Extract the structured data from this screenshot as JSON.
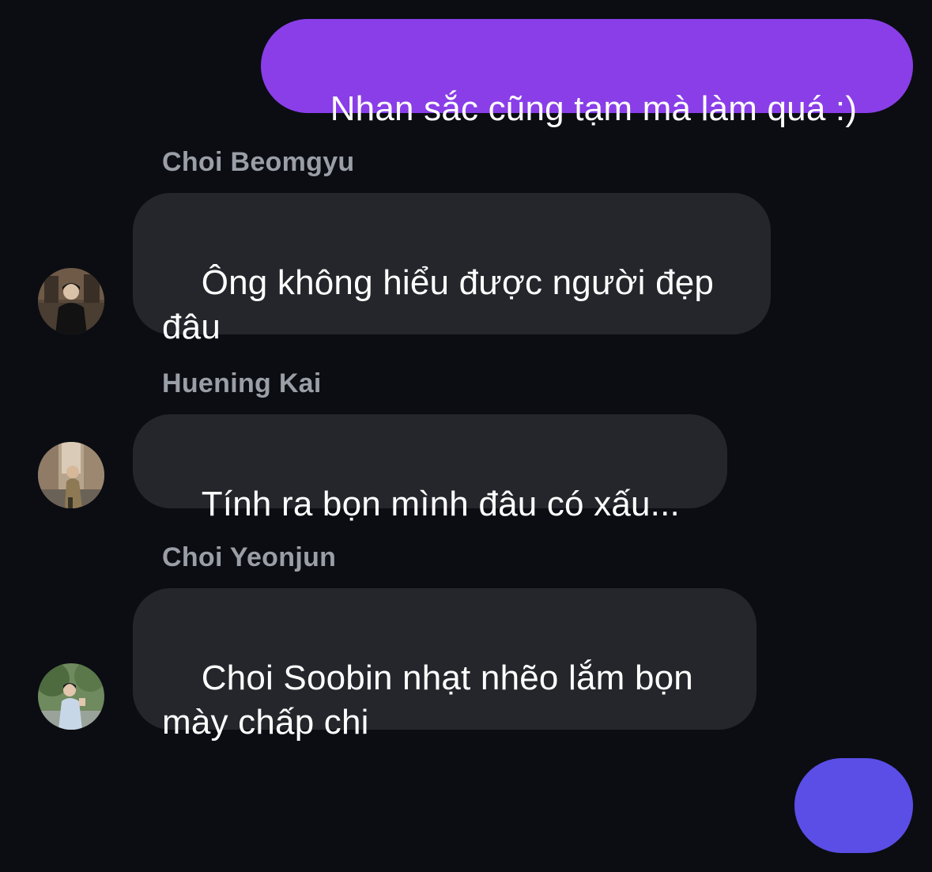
{
  "colors": {
    "background": "#0b0d13",
    "outgoing_bubble_1": "#8a3ee8",
    "outgoing_bubble_2": "#5b4ee6",
    "incoming_bubble": "#24262b",
    "sender_name": "#9a9ea6",
    "message_text": "#ffffff"
  },
  "messages": [
    {
      "direction": "outgoing",
      "text": "Nhan sắc cũng tạm mà làm quá :)"
    },
    {
      "direction": "incoming",
      "sender": "Choi Beomgyu",
      "text": "Ông không hiểu được người đẹp\nđâu",
      "avatar": "avatar-photo"
    },
    {
      "direction": "incoming",
      "sender": "Huening Kai",
      "text": "Tính ra bọn mình đâu có xấu...",
      "avatar": "avatar-photo"
    },
    {
      "direction": "incoming",
      "sender": "Choi Yeonjun",
      "text": "Choi Soobin nhạt nhẽo lắm bọn\nmày chấp chi",
      "avatar": "avatar-photo"
    },
    {
      "direction": "outgoing",
      "text": ":)..."
    }
  ]
}
